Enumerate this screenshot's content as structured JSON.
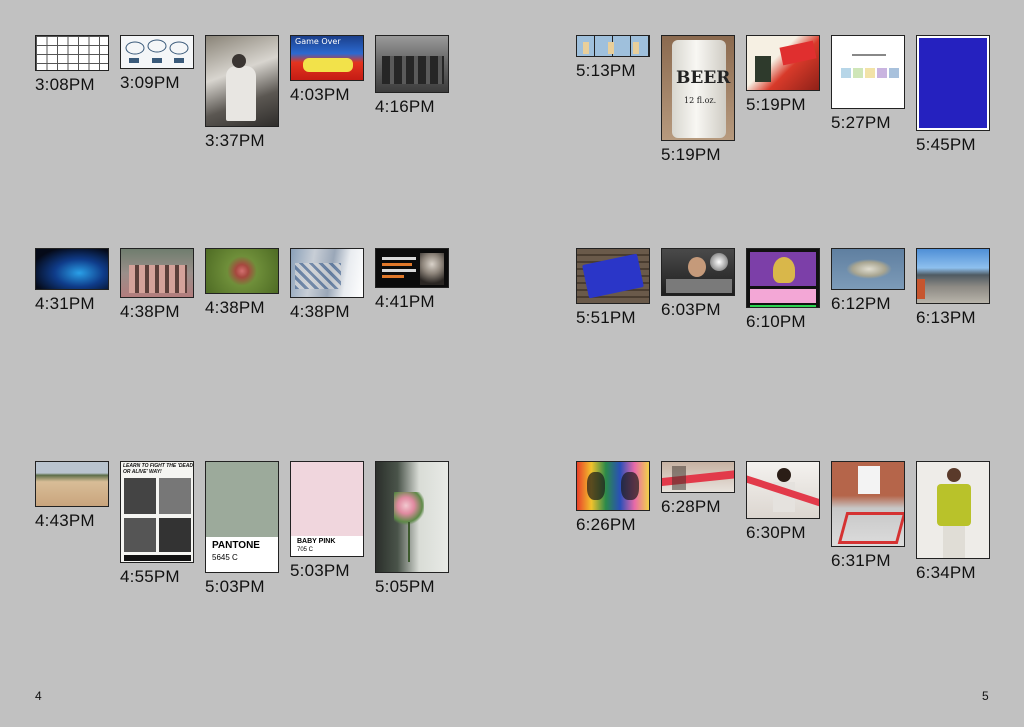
{
  "page_left": "4",
  "page_right": "5",
  "items": [
    {
      "time": "3:08PM",
      "desc": "grid-thumbnail"
    },
    {
      "time": "3:09PM",
      "desc": "cloud-diagram-thumbnail"
    },
    {
      "time": "3:37PM",
      "desc": "person-cooking-thumbnail"
    },
    {
      "time": "4:03PM",
      "desc": "game-over-car-thumbnail",
      "caption": "Game Over"
    },
    {
      "time": "4:16PM",
      "desc": "group-photo-thumbnail"
    },
    {
      "time": "4:31PM",
      "desc": "blue-light-stadium-thumbnail"
    },
    {
      "time": "4:38PM",
      "desc": "group-standing-thumbnail"
    },
    {
      "time": "4:38PM",
      "desc": "flower-bud-thumbnail"
    },
    {
      "time": "4:38PM",
      "desc": "graffiti-wall-thumbnail"
    },
    {
      "time": "4:41PM",
      "desc": "quote-portrait-thumbnail"
    },
    {
      "time": "4:43PM",
      "desc": "sand-dunes-thumbnail"
    },
    {
      "time": "4:55PM",
      "desc": "dead-or-alive-poster-thumbnail",
      "caption": "LEARN TO FIGHT THE 'DEAD OR ALIVE' WAY!"
    },
    {
      "time": "5:03PM",
      "desc": "pantone-green-swatch",
      "swatch_name": "PANTONE",
      "swatch_code": "5645 C"
    },
    {
      "time": "5:03PM",
      "desc": "baby-pink-swatch",
      "swatch_name": "BABY PINK",
      "swatch_code": "705 C"
    },
    {
      "time": "5:05PM",
      "desc": "flower-bouquet-thumbnail"
    },
    {
      "time": "5:13PM",
      "desc": "comic-strip-thumbnail"
    },
    {
      "time": "5:19PM",
      "desc": "beer-can-thumbnail",
      "caption": "BEER",
      "caption2": "12 fl.oz."
    },
    {
      "time": "5:19PM",
      "desc": "comic-art-thumbnail"
    },
    {
      "time": "5:27PM",
      "desc": "color-palette-thumbnail"
    },
    {
      "time": "5:45PM",
      "desc": "blue-square-thumbnail"
    },
    {
      "time": "5:51PM",
      "desc": "blue-cassette-thumbnail"
    },
    {
      "time": "6:03PM",
      "desc": "dj-turntable-thumbnail"
    },
    {
      "time": "6:10PM",
      "desc": "cartoon-screen-thumbnail"
    },
    {
      "time": "6:12PM",
      "desc": "floating-islands-thumbnail"
    },
    {
      "time": "6:13PM",
      "desc": "mountain-road-thumbnail"
    },
    {
      "time": "6:26PM",
      "desc": "colorful-faces-art-thumbnail"
    },
    {
      "time": "6:28PM",
      "desc": "tape-collage-thumbnail"
    },
    {
      "time": "6:30PM",
      "desc": "woman-tape-thumbnail"
    },
    {
      "time": "6:31PM",
      "desc": "red-sculpture-thumbnail"
    },
    {
      "time": "6:34PM",
      "desc": "yellow-vest-person-thumbnail"
    }
  ],
  "colors": {
    "background": "#c1c1c1",
    "text": "#111111",
    "border": "#222222"
  }
}
